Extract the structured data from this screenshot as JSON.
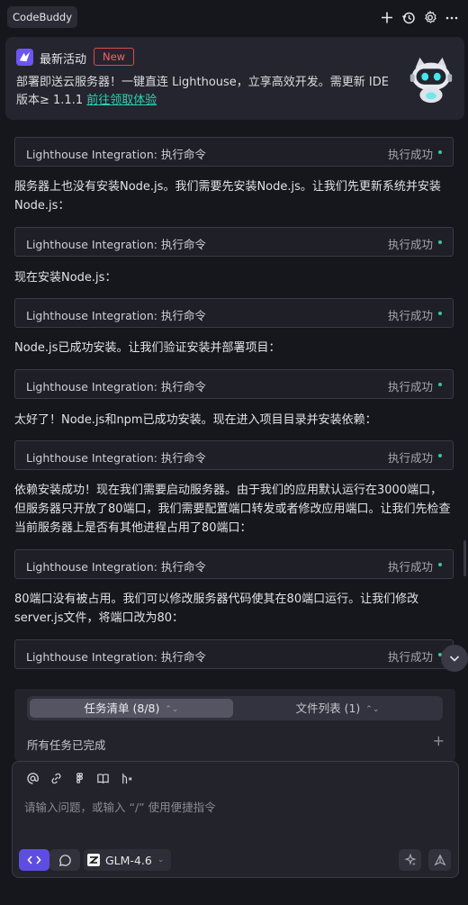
{
  "app": {
    "tab_label": "CodeBuddy"
  },
  "toolbar": {
    "icons": [
      "plus-icon",
      "history-icon",
      "settings-icon",
      "more-icon"
    ]
  },
  "banner": {
    "title": "最新活动",
    "badge": "New",
    "text": "部署即送云服务器！一键直连 Lighthouse，立享高效开发。需更新 IDE 版本≥ 1.1.1 ",
    "link": "前往领取体验"
  },
  "conversation": [
    {
      "type": "command",
      "label": "Lighthouse Integration: 执行命令",
      "status": "执行成功"
    },
    {
      "type": "message",
      "text": "服务器上也没有安装Node.js。我们需要先安装Node.js。让我们先更新系统并安装Node.js："
    },
    {
      "type": "command",
      "label": "Lighthouse Integration: 执行命令",
      "status": "执行成功"
    },
    {
      "type": "message",
      "text": "现在安装Node.js："
    },
    {
      "type": "command",
      "label": "Lighthouse Integration: 执行命令",
      "status": "执行成功"
    },
    {
      "type": "message",
      "text": "Node.js已成功安装。让我们验证安装并部署项目："
    },
    {
      "type": "command",
      "label": "Lighthouse Integration: 执行命令",
      "status": "执行成功"
    },
    {
      "type": "message",
      "text": "太好了！Node.js和npm已成功安装。现在进入项目目录并安装依赖："
    },
    {
      "type": "command",
      "label": "Lighthouse Integration: 执行命令",
      "status": "执行成功"
    },
    {
      "type": "message",
      "text": "依赖安装成功！现在我们需要启动服务器。由于我们的应用默认运行在3000端口，但服务器只开放了80端口，我们需要配置端口转发或者修改应用端口。让我们先检查当前服务器上是否有其他进程占用了80端口："
    },
    {
      "type": "command",
      "label": "Lighthouse Integration: 执行命令",
      "status": "执行成功"
    },
    {
      "type": "message",
      "text": "80端口没有被占用。我们可以修改服务器代码使其在80端口运行。让我们修改server.js文件，将端口改为80："
    },
    {
      "type": "command",
      "label": "Lighthouse Integration: 执行命令",
      "status": "执行成功"
    }
  ],
  "tasks": {
    "tab_tasks": "任务清单 (8/8)",
    "tab_files": "文件列表 (1)",
    "status": "所有任务已完成"
  },
  "input": {
    "placeholder": "请输入问题，或输入 “/” 使用便捷指令",
    "model": "GLM-4.6"
  },
  "colors": {
    "accent": "#5d4de0",
    "link": "#2ed0b2",
    "success_dot": "#38c79a",
    "badge": "#e0484e"
  }
}
